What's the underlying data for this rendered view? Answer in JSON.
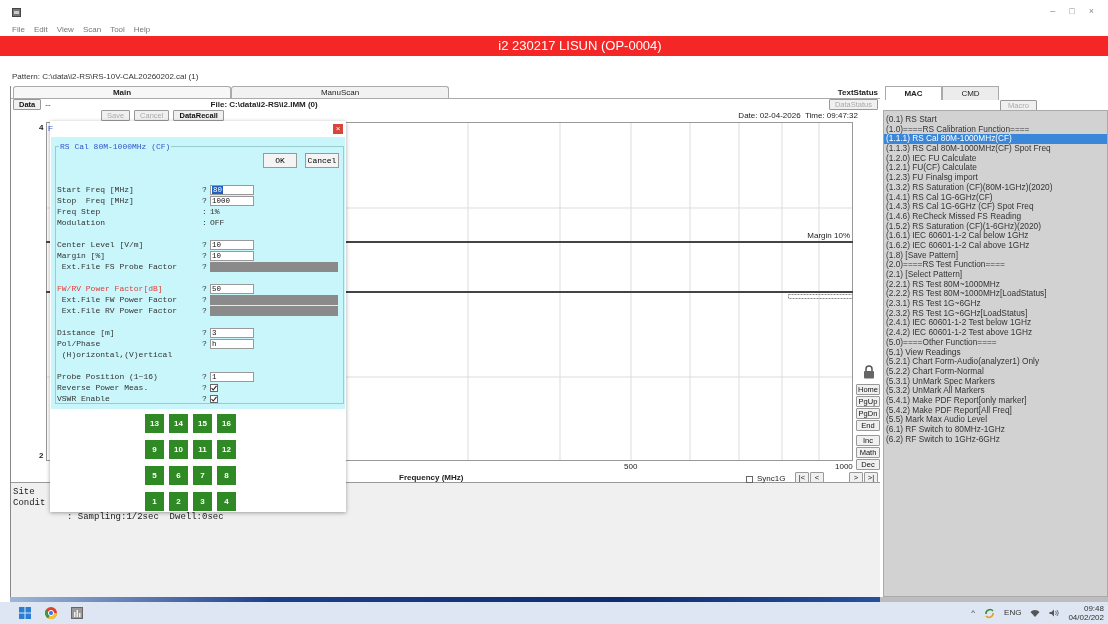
{
  "window": {
    "controls": [
      "–",
      "□",
      "×"
    ]
  },
  "menu": [
    "File",
    "Edit",
    "View",
    "Scan",
    "Tool",
    "Help"
  ],
  "banner": "i2 230217 LISUN (OP-0004)",
  "pattern": "Pattern: C:\\data\\i2-RS\\RS-10V-CAL20260202.cal (1)",
  "tabs": [
    {
      "label": "Main",
      "selected": true
    },
    {
      "label": "ManuScan",
      "selected": false
    }
  ],
  "text_status": "TextStatus",
  "data_button": "Data",
  "data_dash": "--",
  "file": "File: C:\\data\\i2-RS\\i2.IMM (0)",
  "data_status": {
    "label": "DataStatus",
    "disabled": true
  },
  "actions": [
    {
      "label": "Save",
      "disabled": true
    },
    {
      "label": "Cancel",
      "disabled": true
    },
    {
      "label": "DataRecall",
      "disabled": false
    }
  ],
  "timestamp": "Date: 02-04-2026  Time: 09:47:32",
  "chart": {
    "y_labels": [
      "4",
      "2"
    ],
    "x_labels": [
      "500",
      "1000"
    ],
    "x_title": "Frequency (MHz)",
    "margin_label": "Margin 10%"
  },
  "nav_buttons": [
    "Home",
    "PgUp",
    "PgDn",
    "End"
  ],
  "math_buttons": [
    "Inc",
    "Math",
    "Dec"
  ],
  "sync": {
    "label": "Sync1G",
    "checked": false
  },
  "step_buttons": [
    "|<",
    "<",
    ">",
    ">|"
  ],
  "status_lines": [
    "Site",
    "Condit",
    ": Sampling:1/2sec  Dwell:0sec"
  ],
  "dialog": {
    "caption": "F",
    "close": "×",
    "title": "RS Cal 80M-1000MHz (CF)",
    "buttons": [
      "OK",
      "Cancel"
    ],
    "groups": [
      [
        {
          "kind": "input",
          "label": "Start Freq [MHz]",
          "prompt": "?",
          "value": "80",
          "highlighted": true,
          "warning": false
        },
        {
          "kind": "input",
          "label": "Stop  Freq [MHz]",
          "prompt": "?",
          "value": "1000",
          "highlighted": false,
          "warning": false
        },
        {
          "kind": "static",
          "label": "Freq Step",
          "prompt": ":",
          "value": "1%",
          "warning": false
        },
        {
          "kind": "static",
          "label": "Modulation",
          "prompt": ":",
          "value": "OFF",
          "warning": false
        }
      ],
      [
        {
          "kind": "input",
          "label": "Center Level [V/m]",
          "prompt": "?",
          "value": "10",
          "highlighted": false,
          "warning": false
        },
        {
          "kind": "input",
          "label": "Margin [%]",
          "prompt": "?",
          "value": "10",
          "highlighted": false,
          "warning": false
        },
        {
          "kind": "file",
          "label": " Ext.File FS Probe Factor",
          "prompt": "?",
          "warning": false
        }
      ],
      [
        {
          "kind": "input",
          "label": "FW/RV Power Factor[dB]",
          "prompt": "?",
          "value": "50",
          "highlighted": false,
          "warning": true
        },
        {
          "kind": "file",
          "label": " Ext.File FW Power Factor",
          "prompt": "?",
          "warning": false
        },
        {
          "kind": "file",
          "label": " Ext.File RV Power Factor",
          "prompt": "?",
          "warning": false
        }
      ],
      [
        {
          "kind": "input",
          "label": "Distance [m]",
          "prompt": "?",
          "value": "3",
          "highlighted": false,
          "warning": false
        },
        {
          "kind": "input",
          "label": "Pol/Phase",
          "prompt": "?",
          "value": "h",
          "highlighted": false,
          "warning": false
        },
        {
          "kind": "note",
          "label": " (H)orizontal,(V)ertical",
          "warning": false
        }
      ],
      [
        {
          "kind": "input",
          "label": "Probe Position (1~16)",
          "prompt": "?",
          "value": "1",
          "highlighted": false,
          "warning": false
        },
        {
          "kind": "checkbox",
          "label": "Reverse Power Meas.",
          "prompt": "?",
          "checked": true,
          "warning": false
        },
        {
          "kind": "checkbox",
          "label": "VSWR Enable",
          "prompt": "?",
          "checked": true,
          "warning": false
        }
      ]
    ],
    "keypad": [
      [
        "13",
        "14",
        "15",
        "16"
      ],
      [
        "9",
        "10",
        "11",
        "12"
      ],
      [
        "5",
        "6",
        "7",
        "8"
      ],
      [
        "1",
        "2",
        "3",
        "4"
      ]
    ]
  },
  "side_tabs": [
    {
      "label": "MAC",
      "selected": true
    },
    {
      "label": "CMD",
      "selected": false
    }
  ],
  "macro_button": {
    "label": "Macro",
    "disabled": true
  },
  "macros": [
    {
      "label": "(0.1) RS Start",
      "selected": false
    },
    {
      "label": "(1.0)====RS Calibration Function====",
      "selected": false
    },
    {
      "label": "(1.1.1) RS Cal 80M-1000MHz(CF)",
      "selected": true
    },
    {
      "label": "(1.1.3) RS Cal 80M-1000MHz(CF) Spot Freq",
      "selected": false
    },
    {
      "label": "(1.2.0) IEC FU Calculate",
      "selected": false
    },
    {
      "label": "(1.2.1) FU(CF) Calculate",
      "selected": false
    },
    {
      "label": "(1.2.3) FU Finalsg import",
      "selected": false
    },
    {
      "label": "(1.3.2) RS Saturation (CF)(80M-1GHz)(2020)",
      "selected": false
    },
    {
      "label": "(1.4.1) RS Cal 1G-6GHz(CF)",
      "selected": false
    },
    {
      "label": "(1.4.3) RS Cal 1G-6GHz (CF) Spot Freq",
      "selected": false
    },
    {
      "label": "(1.4.6) ReCheck Missed FS Reading",
      "selected": false
    },
    {
      "label": "(1.5.2) RS Saturation (CF)(1-6GHz)(2020)",
      "selected": false
    },
    {
      "label": "(1.6.1) IEC 60601-1-2 Cal below 1GHz",
      "selected": false
    },
    {
      "label": "(1.6.2) IEC 60601-1-2 Cal above 1GHz",
      "selected": false
    },
    {
      "label": "(1.8) [Save Pattern]",
      "selected": false
    },
    {
      "label": "(2.0)====RS Test Function====",
      "selected": false
    },
    {
      "label": "(2.1) [Select Pattern]",
      "selected": false
    },
    {
      "label": "(2.2.1) RS Test 80M~1000MHz",
      "selected": false
    },
    {
      "label": "(2.2.2) RS Test 80M~1000MHz[LoadStatus]",
      "selected": false
    },
    {
      "label": "(2.3.1) RS Test 1G~6GHz",
      "selected": false
    },
    {
      "label": "(2.3.2) RS Test 1G~6GHz[LoadStatus]",
      "selected": false
    },
    {
      "label": "(2.4.1) IEC 60601-1-2 Test below 1GHz",
      "selected": false
    },
    {
      "label": "(2.4.2) IEC 60601-1-2 Test above 1GHz",
      "selected": false
    },
    {
      "label": "(5.0)====Other Function====",
      "selected": false
    },
    {
      "label": "(5.1) View Readings",
      "selected": false
    },
    {
      "label": "(5.2.1) Chart Form-Audio(analyzer1) Only",
      "selected": false
    },
    {
      "label": "(5.2.2) Chart Form-Normal",
      "selected": false
    },
    {
      "label": "(5.3.1) UnMark Spec Markers",
      "selected": false
    },
    {
      "label": "(5.3.2) UnMark All Markers",
      "selected": false
    },
    {
      "label": "(5.4.1) Make PDF Report[only marker]",
      "selected": false
    },
    {
      "label": "(5.4.2) Make PDF Report[All Freq]",
      "selected": false
    },
    {
      "label": "(5.5) Mark Max Audio Level",
      "selected": false
    },
    {
      "label": "(6.1) RF Switch to 80MHz-1GHz",
      "selected": false
    },
    {
      "label": "(6.2) RF Switch to 1GHz-6GHz",
      "selected": false
    }
  ],
  "taskbar": {
    "caret": "^",
    "language": "ENG",
    "time": "09:48",
    "date": "04/02/202"
  }
}
